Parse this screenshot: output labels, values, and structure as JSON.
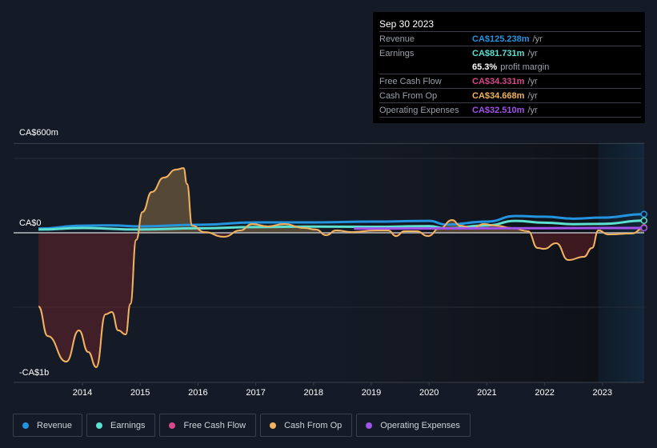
{
  "tooltip": {
    "date": "Sep 30 2023",
    "rows": [
      {
        "label": "Revenue",
        "value": "CA$125.238m",
        "unit": "/yr",
        "color": "#2394df"
      },
      {
        "label": "Earnings",
        "value": "CA$81.731m",
        "unit": "/yr",
        "color": "#5ce0cf"
      },
      {
        "label": "",
        "value": "65.3%",
        "unit": "profit margin",
        "color": "#ffffff"
      },
      {
        "label": "Free Cash Flow",
        "value": "CA$34.331m",
        "unit": "/yr",
        "color": "#d6498a"
      },
      {
        "label": "Cash From Op",
        "value": "CA$34.668m",
        "unit": "/yr",
        "color": "#f0b45e"
      },
      {
        "label": "Operating Expenses",
        "value": "CA$32.510m",
        "unit": "/yr",
        "color": "#a352eb"
      }
    ]
  },
  "chart_data": {
    "type": "line",
    "ylabel_top": "CA$600m",
    "ylabel_zero": "CA$0",
    "ylabel_bottom": "-CA$1b",
    "ylim": [
      -1000,
      600
    ],
    "xlim": [
      2013.24,
      2023.72
    ],
    "x_ticks": [
      "2014",
      "2015",
      "2016",
      "2017",
      "2018",
      "2019",
      "2020",
      "2021",
      "2022",
      "2023"
    ],
    "units": "CA$ millions",
    "forecast_shade_from": 2022.93,
    "series": [
      {
        "name": "Revenue",
        "color": "#2394df",
        "points": [
          [
            2013.24,
            28
          ],
          [
            2014,
            48
          ],
          [
            2014.5,
            50
          ],
          [
            2015,
            43
          ],
          [
            2016,
            54
          ],
          [
            2017,
            70
          ],
          [
            2018,
            70
          ],
          [
            2019,
            75
          ],
          [
            2020,
            80
          ],
          [
            2020.3,
            55
          ],
          [
            2021,
            75
          ],
          [
            2021.5,
            113
          ],
          [
            2022,
            108
          ],
          [
            2022.5,
            95
          ],
          [
            2023,
            102
          ],
          [
            2023.72,
            125.238
          ]
        ]
      },
      {
        "name": "Earnings",
        "color": "#5ce0cf",
        "points": [
          [
            2013.24,
            22
          ],
          [
            2014,
            32
          ],
          [
            2015,
            22
          ],
          [
            2016,
            30
          ],
          [
            2017,
            38
          ],
          [
            2018,
            42
          ],
          [
            2019,
            40
          ],
          [
            2020,
            45
          ],
          [
            2020.3,
            30
          ],
          [
            2021,
            50
          ],
          [
            2021.5,
            80
          ],
          [
            2022,
            68
          ],
          [
            2022.5,
            58
          ],
          [
            2023,
            60
          ],
          [
            2023.72,
            81.731
          ]
        ]
      },
      {
        "name": "Free Cash Flow",
        "color": "#d6498a",
        "points": [
          [
            2013.24,
            -495
          ],
          [
            2013.4,
            -694
          ],
          [
            2013.72,
            -866
          ],
          [
            2013.94,
            -656
          ],
          [
            2014.1,
            -801
          ],
          [
            2014.24,
            -903
          ],
          [
            2014.4,
            -548
          ],
          [
            2014.51,
            -532
          ],
          [
            2014.62,
            -656
          ],
          [
            2014.75,
            -683
          ],
          [
            2014.83,
            -478
          ],
          [
            2014.93,
            -48
          ],
          [
            2015.04,
            140
          ],
          [
            2015.2,
            274
          ],
          [
            2015.41,
            371
          ],
          [
            2015.62,
            425
          ],
          [
            2015.75,
            435
          ],
          [
            2015.81,
            328
          ],
          [
            2015.9,
            48
          ],
          [
            2016.11,
            5
          ],
          [
            2016.45,
            -27
          ],
          [
            2016.73,
            16
          ],
          [
            2016.94,
            59
          ],
          [
            2017.21,
            43
          ],
          [
            2017.49,
            59
          ],
          [
            2017.84,
            32
          ],
          [
            2018.04,
            22
          ],
          [
            2018.22,
            -16
          ],
          [
            2018.39,
            16
          ],
          [
            2018.67,
            5
          ],
          [
            2019.08,
            16
          ],
          [
            2019.29,
            16
          ],
          [
            2019.43,
            -22
          ],
          [
            2019.57,
            11
          ],
          [
            2019.78,
            11
          ],
          [
            2019.98,
            -22
          ],
          [
            2020.19,
            32
          ],
          [
            2020.4,
            86
          ],
          [
            2020.54,
            48
          ],
          [
            2020.75,
            32
          ],
          [
            2020.95,
            59
          ],
          [
            2021.16,
            48
          ],
          [
            2021.44,
            32
          ],
          [
            2021.71,
            11
          ],
          [
            2021.88,
            -102
          ],
          [
            2021.99,
            -108
          ],
          [
            2022.2,
            -70
          ],
          [
            2022.41,
            -183
          ],
          [
            2022.68,
            -161
          ],
          [
            2022.82,
            -102
          ],
          [
            2022.93,
            16
          ],
          [
            2023.1,
            -11
          ],
          [
            2023.51,
            -5
          ],
          [
            2023.72,
            34.331
          ]
        ]
      },
      {
        "name": "Cash From Op",
        "color": "#f0b45e",
        "points": [
          [
            2013.24,
            -495
          ],
          [
            2013.4,
            -694
          ],
          [
            2013.72,
            -866
          ],
          [
            2013.94,
            -656
          ],
          [
            2014.1,
            -801
          ],
          [
            2014.24,
            -903
          ],
          [
            2014.4,
            -548
          ],
          [
            2014.51,
            -532
          ],
          [
            2014.62,
            -656
          ],
          [
            2014.75,
            -683
          ],
          [
            2014.83,
            -478
          ],
          [
            2014.93,
            -48
          ],
          [
            2015.04,
            140
          ],
          [
            2015.2,
            274
          ],
          [
            2015.41,
            371
          ],
          [
            2015.62,
            425
          ],
          [
            2015.75,
            435
          ],
          [
            2015.81,
            328
          ],
          [
            2015.9,
            48
          ],
          [
            2016.11,
            5
          ],
          [
            2016.45,
            -27
          ],
          [
            2016.73,
            16
          ],
          [
            2016.94,
            59
          ],
          [
            2017.21,
            43
          ],
          [
            2017.49,
            59
          ],
          [
            2017.84,
            32
          ],
          [
            2018.04,
            22
          ],
          [
            2018.22,
            -16
          ],
          [
            2018.39,
            16
          ],
          [
            2018.67,
            5
          ],
          [
            2019.08,
            16
          ],
          [
            2019.29,
            16
          ],
          [
            2019.43,
            -22
          ],
          [
            2019.57,
            11
          ],
          [
            2019.78,
            11
          ],
          [
            2019.98,
            -22
          ],
          [
            2020.19,
            32
          ],
          [
            2020.4,
            86
          ],
          [
            2020.54,
            48
          ],
          [
            2020.75,
            32
          ],
          [
            2020.95,
            59
          ],
          [
            2021.16,
            48
          ],
          [
            2021.44,
            32
          ],
          [
            2021.71,
            11
          ],
          [
            2021.88,
            -102
          ],
          [
            2021.99,
            -108
          ],
          [
            2022.2,
            -70
          ],
          [
            2022.41,
            -183
          ],
          [
            2022.68,
            -161
          ],
          [
            2022.82,
            -102
          ],
          [
            2022.93,
            16
          ],
          [
            2023.1,
            -11
          ],
          [
            2023.51,
            -5
          ],
          [
            2023.72,
            34.668
          ]
        ]
      },
      {
        "name": "Operating Expenses",
        "color": "#a352eb",
        "points": [
          [
            2018.7,
            28
          ],
          [
            2023.72,
            32.51
          ]
        ]
      }
    ]
  }
}
